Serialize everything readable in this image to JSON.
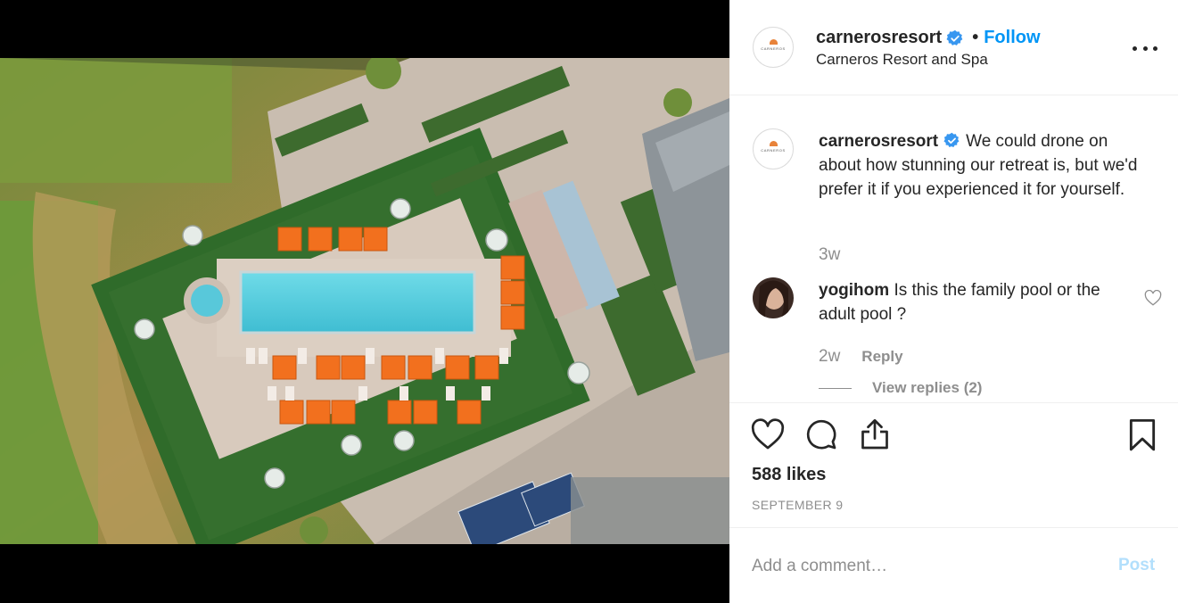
{
  "post": {
    "username": "carnerosresort",
    "follow_label": "Follow",
    "separator": "•",
    "location": "Carneros Resort and Spa",
    "avatar_wordmark": "CARNEROS",
    "caption": {
      "username": "carnerosresort",
      "text": "We could drone on about how stunning our retreat is, but we'd prefer it if you experienced it for yourself.",
      "time": "3w"
    },
    "comments": [
      {
        "username": "yogihom",
        "text": "Is this the family pool or the adult pool ?",
        "time": "2w",
        "reply_label": "Reply",
        "view_replies": "View replies (2)"
      }
    ],
    "likes": "588 likes",
    "date": "SEPTEMBER 9",
    "comment_box": {
      "placeholder": "Add a comment…",
      "post_label": "Post"
    }
  },
  "colors": {
    "link_blue": "#0095f6",
    "post_disabled": "#b2dffc",
    "text_primary": "#262626",
    "text_secondary": "#8e8e8e",
    "verified_blue": "#3897f0",
    "umbrella_orange": "#f2701e",
    "pool_blue": "#4cc8dc"
  },
  "icons": {
    "header": [
      "verified-badge-icon",
      "more-options-icon"
    ],
    "actions": [
      "heart-icon",
      "comment-icon",
      "share-icon",
      "bookmark-icon"
    ],
    "comment": [
      "comment-like-heart-icon"
    ]
  }
}
